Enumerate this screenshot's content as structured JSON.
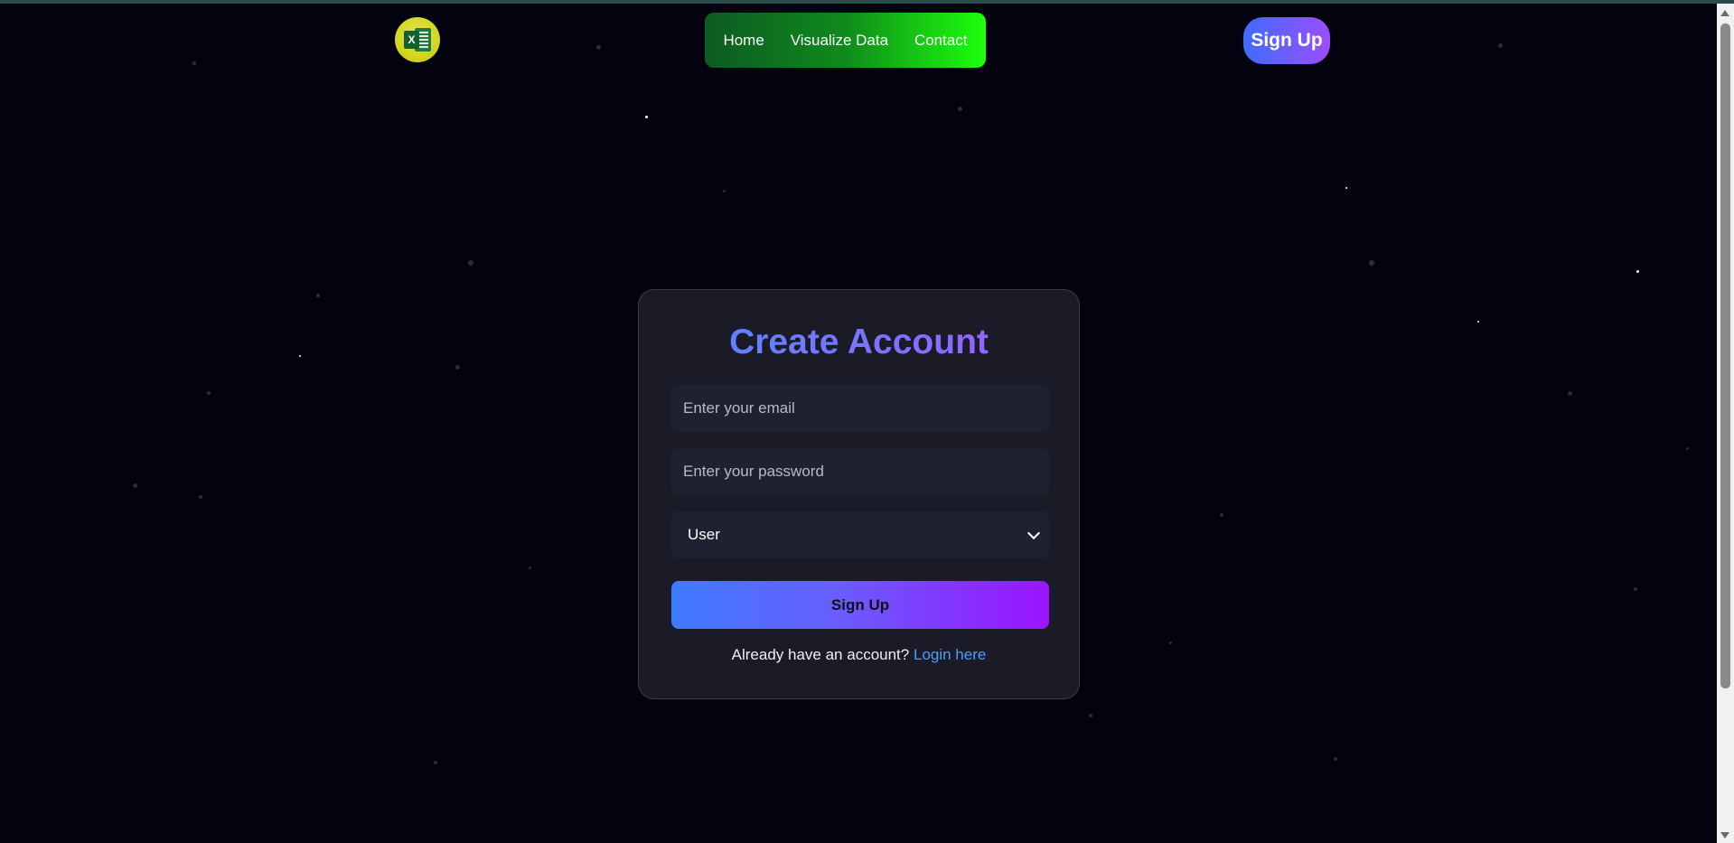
{
  "header": {
    "logo_icon": "excel-logo-icon",
    "logo_letter": "X",
    "nav": [
      "Home",
      "Visualize Data",
      "Contact"
    ],
    "signup_button": "Sign Up"
  },
  "form": {
    "title": "Create Account",
    "email_placeholder": "Enter your email",
    "password_placeholder": "Enter your password",
    "role_selected": "User",
    "submit_label": "Sign Up",
    "login_prompt": "Already have an account?",
    "login_link": "Login here"
  },
  "colors": {
    "background": "#03030f",
    "card": "#1a1b26",
    "accent_blue": "#3d7bff",
    "accent_purple": "#9a14ff",
    "nav_green": "#1dff0c",
    "link": "#4d9cff"
  }
}
